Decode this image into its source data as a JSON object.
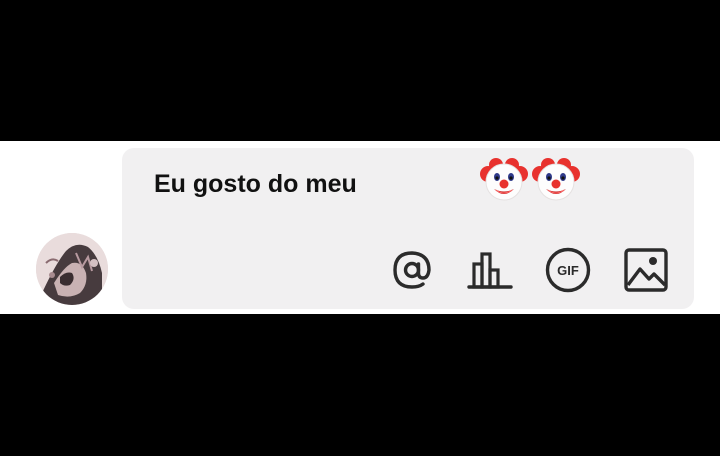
{
  "composer": {
    "text": "Eu gosto do meu",
    "emojis": [
      "clown-face",
      "clown-face"
    ]
  },
  "toolbar": {
    "items": [
      {
        "icon": "mention-icon"
      },
      {
        "icon": "poll-icon"
      },
      {
        "icon": "gif-icon",
        "label": "GIF"
      },
      {
        "icon": "image-icon"
      }
    ]
  },
  "colors": {
    "background_bars": "#000000",
    "strip": "#ffffff",
    "composer_bg": "#f1f0f1",
    "icon": "#2b2b2b",
    "text": "#111111"
  }
}
